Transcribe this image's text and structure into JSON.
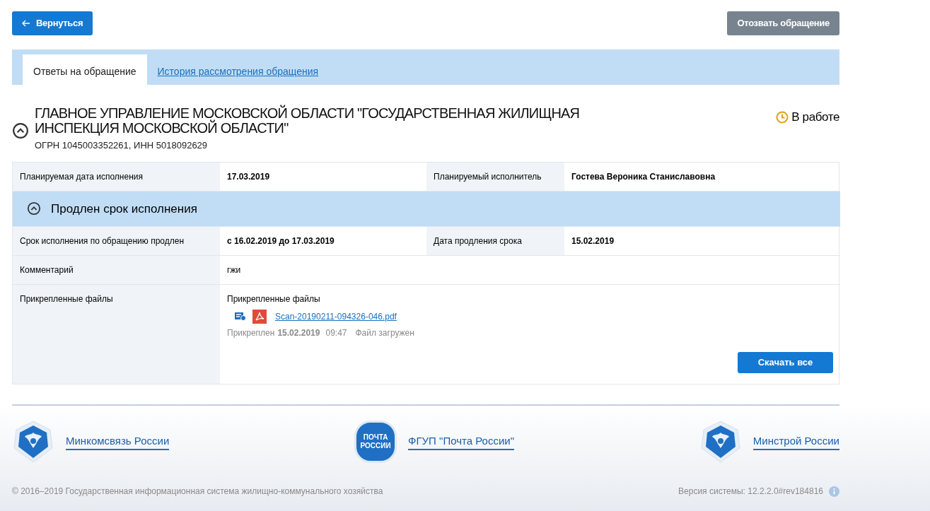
{
  "back_button": {
    "label": "Вернуться"
  },
  "revoke_button": {
    "label": "Отозвать обращение"
  },
  "tabs": [
    {
      "label": "Ответы на обращение",
      "selected": true
    },
    {
      "label": "История рассмотрения обращения",
      "selected": false
    }
  ],
  "organization": {
    "title": "ГЛАВНОЕ УПРАВЛЕНИЕ МОСКОВСКОЙ ОБЛАСТИ \"ГОСУДАРСТВЕННАЯ ЖИЛИЩНАЯ ИНСПЕКЦИЯ МОСКОВСКОЙ ОБЛАСТИ\"",
    "ids": "ОГРН 1045003352261, ИНН 5018092629",
    "expanded": true,
    "status": "В работе"
  },
  "plan_row": [
    {
      "label": "Планируемая дата исполнения",
      "value": "17.03.2019"
    },
    {
      "label": "Планируемый исполнитель",
      "value": "Гостева Вероника Станиславовна"
    }
  ],
  "section": {
    "title": "Продлен срок исполнения",
    "expanded": true
  },
  "section_rows": [
    [
      {
        "label": "Срок исполнения по обращению продлен",
        "value": "с 16.02.2019 до 17.03.2019"
      },
      {
        "label": "Дата продления срока",
        "value": "15.02.2019"
      }
    ],
    [
      {
        "label": "Комментарий",
        "value": "гжи",
        "plain": true
      }
    ]
  ],
  "files": {
    "label": "Прикрепленные файлы",
    "heading": "Прикрепленные файлы",
    "items": [
      {
        "name": "Scan-20190211-094326-046.pdf",
        "attached_label": "Прикреплен",
        "date": "15.02.2019",
        "time": "09:47",
        "state": "Файл загружен"
      }
    ],
    "download_button": "Скачать все"
  },
  "footer": {
    "links": [
      {
        "kind": "emblem",
        "label": "Минкомсвязь России"
      },
      {
        "kind": "post",
        "logo_text": "ПОЧТА РОССИИ",
        "label": "ФГУП \"Почта России\""
      },
      {
        "kind": "emblem",
        "label": "Минстрой России"
      }
    ],
    "copyright": "© 2016–2019 Государственная информационная система жилищно-коммунального хозяйства",
    "version": "Версия системы: 12.2.2.0#rev184816"
  }
}
